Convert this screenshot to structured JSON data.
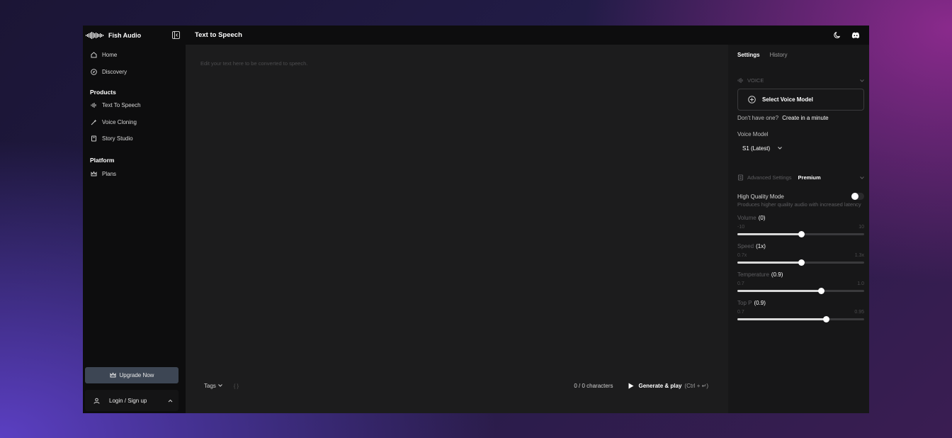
{
  "sidebar": {
    "brand": "Fish Audio",
    "nav_top": [
      {
        "label": "Home",
        "icon": "home-icon"
      },
      {
        "label": "Discovery",
        "icon": "compass-icon"
      }
    ],
    "products_title": "Products",
    "products": [
      {
        "label": "Text To Speech",
        "icon": "waveform-icon"
      },
      {
        "label": "Voice Cloning",
        "icon": "magic-wand-icon"
      },
      {
        "label": "Story Studio",
        "icon": "book-icon"
      }
    ],
    "platform_title": "Platform",
    "platform": [
      {
        "label": "Plans",
        "icon": "crown-icon"
      }
    ],
    "upgrade_label": "Upgrade Now",
    "login_label": "Login / Sign up"
  },
  "header": {
    "title": "Text to Speech"
  },
  "editor": {
    "placeholder": "Edit your text here to be converted to speech.",
    "tags_label": "Tags",
    "braces": "{ }",
    "char_count": "0 / 0 characters",
    "generate_label": "Generate & play",
    "generate_shortcut": "(Ctrl + ↵)"
  },
  "settings": {
    "tabs": [
      {
        "label": "Settings",
        "active": true
      },
      {
        "label": "History",
        "active": false
      }
    ],
    "voice_section": "VOICE",
    "select_voice_label": "Select Voice Model",
    "no_voice_text": "Don't have one?",
    "create_link": "Create in a minute",
    "voice_model_label": "Voice Model",
    "voice_model_value": "S1 (Latest)",
    "advanced_label": "Advanced Settings",
    "premium_label": "Premium",
    "hq_label": "High Quality Mode",
    "hq_desc": "Produces higher quality audio with increased latency",
    "hq_enabled": false,
    "sliders": [
      {
        "label": "Volume",
        "value_text": "(0)",
        "min": "-10",
        "max": "10",
        "fraction": 0.5
      },
      {
        "label": "Speed",
        "value_text": "(1x)",
        "min": "0.7x",
        "max": "1.3x",
        "fraction": 0.5
      },
      {
        "label": "Temperature",
        "value_text": "(0.9)",
        "min": "0.7",
        "max": "1.0",
        "fraction": 0.66
      },
      {
        "label": "Top P",
        "value_text": "(0.9)",
        "min": "0.7",
        "max": "0.95",
        "fraction": 0.7
      }
    ]
  },
  "colors": {
    "sidebar_bg": "#0d0d0e",
    "editor_bg": "#1c1c1d",
    "settings_bg": "#171718",
    "upgrade_bg": "#3d4654"
  }
}
